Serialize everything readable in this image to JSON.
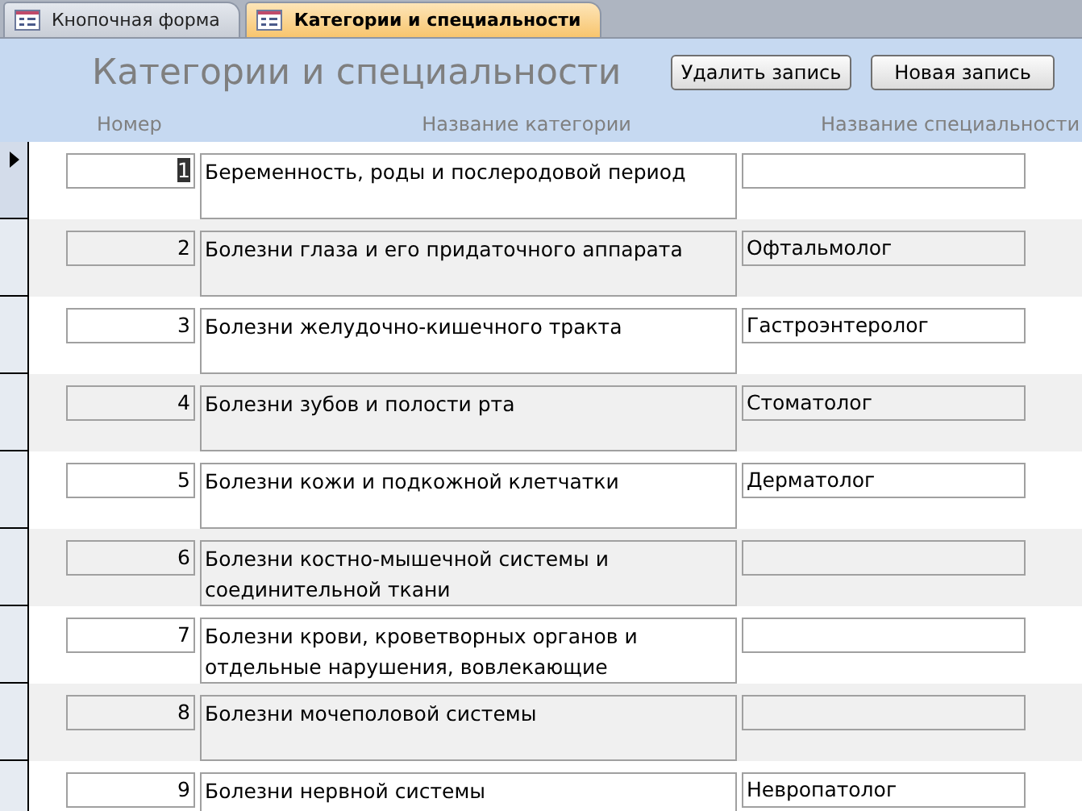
{
  "tabs": [
    {
      "label": "Кнопочная форма",
      "selected": false
    },
    {
      "label": "Категории и специальности",
      "selected": true
    }
  ],
  "form": {
    "title": "Категории и специальности",
    "buttons": [
      "Удалить запись",
      "Новая запись"
    ],
    "columns": [
      "Номер",
      "Название категории",
      "Название специальности"
    ]
  },
  "rows": [
    {
      "number": "1",
      "category": "Беременность, роды и послеродовой период",
      "specialty": "",
      "selected": true
    },
    {
      "number": "2",
      "category": "Болезни глаза и его придаточного аппарата",
      "specialty": "Офтальмолог",
      "selected": false
    },
    {
      "number": "3",
      "category": "Болезни желудочно-кишечного тракта",
      "specialty": "Гастроэнтеролог",
      "selected": false
    },
    {
      "number": "4",
      "category": "Болезни зубов и полости рта",
      "specialty": "Стоматолог",
      "selected": false
    },
    {
      "number": "5",
      "category": "Болезни кожи и подкожной клетчатки",
      "specialty": "Дерматолог",
      "selected": false
    },
    {
      "number": "6",
      "category": "Болезни костно-мышечной системы и соединительной ткани",
      "specialty": "",
      "selected": false
    },
    {
      "number": "7",
      "category": "Болезни крови, кроветворных органов и отдельные нарушения, вовлекающие",
      "specialty": "",
      "selected": false
    },
    {
      "number": "8",
      "category": "Болезни мочеполовой системы",
      "specialty": "",
      "selected": false
    },
    {
      "number": "9",
      "category": "Болезни нервной системы",
      "specialty": "Невропатолог",
      "selected": false
    }
  ]
}
